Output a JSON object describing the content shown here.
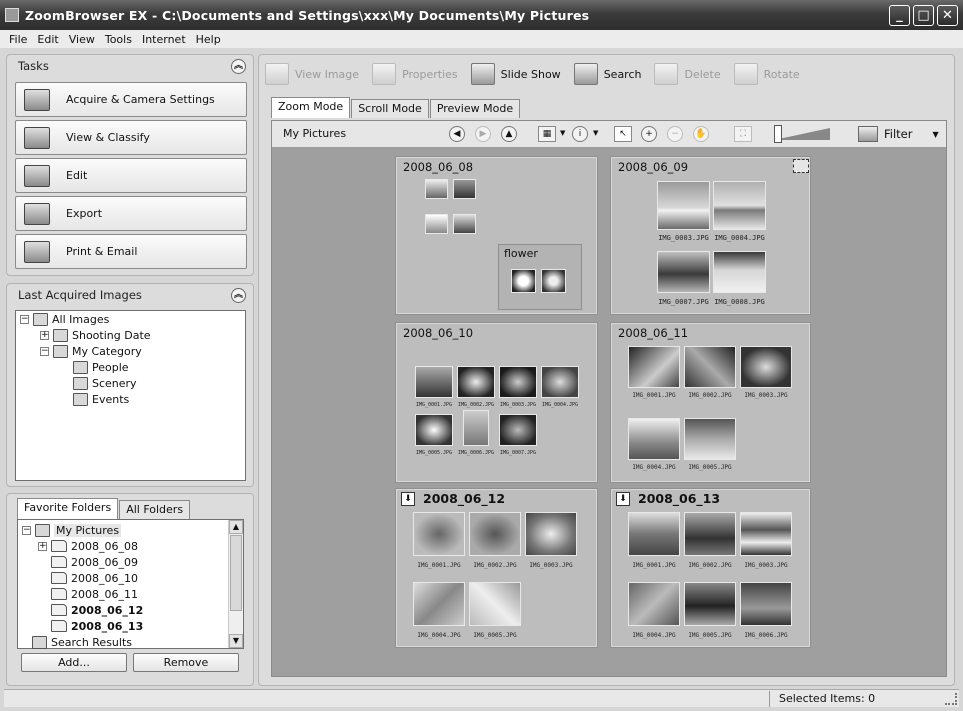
{
  "window": {
    "title": "ZoomBrowser EX  -  C:\\Documents and Settings\\xxx\\My Documents\\My Pictures",
    "minimize": "_",
    "maximize": "□",
    "close": "✕"
  },
  "menu": [
    "File",
    "Edit",
    "View",
    "Tools",
    "Internet",
    "Help"
  ],
  "tasks": {
    "title": "Tasks",
    "buttons": [
      "Acquire & Camera Settings",
      "View & Classify",
      "Edit",
      "Export",
      "Print & Email"
    ]
  },
  "last_acquired": {
    "title": "Last Acquired Images",
    "tree": {
      "root": "All Images",
      "shooting_date": "Shooting Date",
      "category": "My Category",
      "people": "People",
      "scenery": "Scenery",
      "events": "Events"
    }
  },
  "folders": {
    "tabs": [
      "Favorite Folders",
      "All Folders"
    ],
    "root": "My Pictures",
    "items": [
      "2008_06_08",
      "2008_06_09",
      "2008_06_10",
      "2008_06_11",
      "2008_06_12",
      "2008_06_13"
    ],
    "search_results": "Search Results",
    "add_button": "Add...",
    "remove_button": "Remove"
  },
  "toolbar": {
    "view_image": "View Image",
    "properties": "Properties",
    "slide_show": "Slide Show",
    "search": "Search",
    "delete": "Delete",
    "rotate": "Rotate"
  },
  "mode_tabs": [
    "Zoom Mode",
    "Scroll Mode",
    "Preview Mode"
  ],
  "viewer": {
    "title": "My Pictures",
    "filter": "Filter"
  },
  "groups": {
    "g0608": {
      "title": "2008_06_08",
      "sub_title": "flower"
    },
    "g0609": {
      "title": "2008_06_09",
      "captions": [
        "IMG_0003.JPG",
        "IMG_0004.JPG",
        "IMG_0007.JPG",
        "IMG_0008.JPG"
      ]
    },
    "g0610": {
      "title": "2008_06_10",
      "captions": [
        "IMG_0001.JPG",
        "IMG_0002.JPG",
        "IMG_0003.JPG",
        "IMG_0004.JPG",
        "IMG_0005.JPG",
        "IMG_0006.JPG",
        "IMG_0007.JPG"
      ]
    },
    "g0611": {
      "title": "2008_06_11",
      "captions": [
        "IMG_0001.JPG",
        "IMG_0002.JPG",
        "IMG_0003.JPG",
        "IMG_0004.JPG",
        "IMG_0005.JPG"
      ]
    },
    "g0612": {
      "title": "2008_06_12",
      "captions": [
        "IMG_0001.JPG",
        "IMG_0002.JPG",
        "IMG_0003.JPG",
        "IMG_0004.JPG",
        "IMG_0005.JPG"
      ]
    },
    "g0613": {
      "title": "2008_06_13",
      "captions": [
        "IMG_0001.JPG",
        "IMG_0002.JPG",
        "IMG_0003.JPG",
        "IMG_0004.JPG",
        "IMG_0005.JPG",
        "IMG_0006.JPG"
      ]
    }
  },
  "status": {
    "selected": "Selected Items: 0"
  }
}
